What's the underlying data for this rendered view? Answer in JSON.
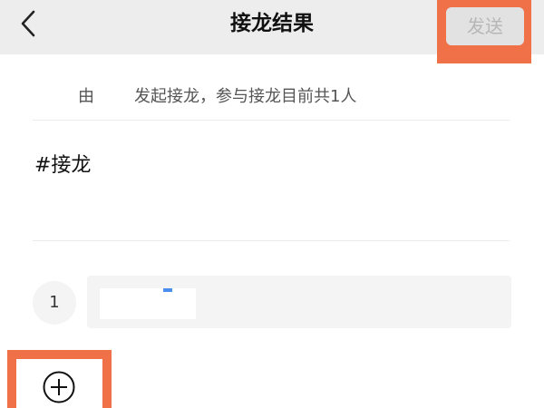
{
  "header": {
    "title": "接龙结果",
    "send_label": "发送"
  },
  "initiator": {
    "prefix": "由",
    "text": "发起接龙，参与接龙目前共1人"
  },
  "topic": "#接龙",
  "entries": [
    {
      "index": "1",
      "value": ""
    }
  ],
  "colors": {
    "header_bg": "#ededed",
    "highlight": "#f07048",
    "send_disabled_text": "#b6b6b6",
    "send_disabled_bg": "#e2e2e2"
  },
  "icons": {
    "back": "chevron-left-icon",
    "add": "plus-circle-icon"
  }
}
